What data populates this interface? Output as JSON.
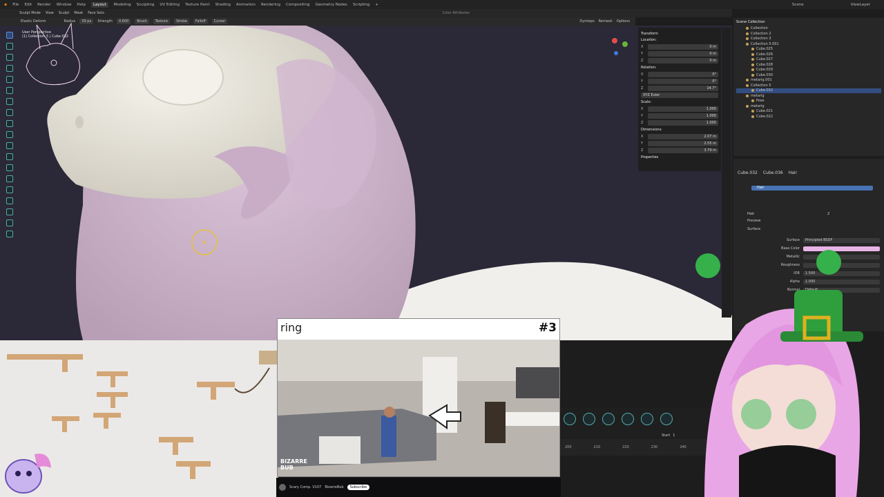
{
  "app": {
    "menu": [
      "File",
      "Edit",
      "Render",
      "Window",
      "Help"
    ],
    "workspaces": [
      "Layout",
      "Modeling",
      "Sculpting",
      "UV Editing",
      "Texture Paint",
      "Shading",
      "Animation",
      "Rendering",
      "Compositing",
      "Geometry Nodes",
      "Scripting"
    ],
    "active_workspace": "Layout",
    "scene": "Scene",
    "view_layer": "ViewLayer"
  },
  "header": {
    "mode": "Sculpt Mode",
    "items": [
      "View",
      "Sculpt",
      "Mask",
      "Face Sets"
    ],
    "right_label": "Color Attributes"
  },
  "tool_header": {
    "brush_name": "Elastic Deform",
    "radius_label": "Radius",
    "radius": "39 px",
    "strength_label": "Strength",
    "strength": "0.600",
    "dropdowns": [
      "Brush",
      "Texture",
      "Stroke",
      "Falloff",
      "Cursor"
    ],
    "right": [
      "Dyntopo",
      "Remesh",
      "Options"
    ]
  },
  "viewport": {
    "overlay_line1": "User Perspective",
    "overlay_line2": "(1) Collection 5 | Cube.032"
  },
  "n_panel": {
    "title": "Transform",
    "location_label": "Location:",
    "location": [
      [
        "X",
        "0 m"
      ],
      [
        "Y",
        "0 m"
      ],
      [
        "Z",
        "0 m"
      ]
    ],
    "rotation_label": "Rotation:",
    "rotation": [
      [
        "X",
        "0°"
      ],
      [
        "Y",
        "0°"
      ],
      [
        "Z",
        "14.7°"
      ]
    ],
    "rotation_mode": "XYZ Euler",
    "scale_label": "Scale:",
    "scale": [
      [
        "X",
        "1.000"
      ],
      [
        "Y",
        "1.000"
      ],
      [
        "Z",
        "1.000"
      ]
    ],
    "dimensions_label": "Dimensions:",
    "dimensions": [
      [
        "X",
        "2.07 m"
      ],
      [
        "Y",
        "2.55 m"
      ],
      [
        "Z",
        "3.79 m"
      ]
    ],
    "properties": "Properties"
  },
  "outliner": {
    "title": "Scene Collection",
    "items": [
      "Collection",
      "Collection 2",
      "Collection 3",
      "Collection 5.001",
      "Cube.025",
      "Cube.026",
      "Cube.027",
      "Cube.028",
      "Cube.029",
      "Cube.030",
      "metarig.001",
      "Collection 5",
      "Cube.032",
      "metarig",
      "Pose",
      "metarig",
      "Cube.021",
      "Cube.022"
    ],
    "selected_index": 12
  },
  "properties": {
    "breadcrumb": [
      "Cube.032",
      "Cube.036",
      "Hair"
    ],
    "slot": "Hair",
    "material": "Hair",
    "material_users": "2",
    "sections": [
      "Preview",
      "Surface"
    ],
    "rows": [
      [
        "Surface",
        "Principled BSDF"
      ],
      [
        "Base Color",
        ""
      ],
      [
        "Metallic",
        ""
      ],
      [
        "Roughness",
        ""
      ],
      [
        "IOR",
        "1.500"
      ],
      [
        "Alpha",
        "1.000"
      ],
      [
        "Normal",
        "Default"
      ]
    ],
    "accent": "#e8b4e6"
  },
  "timeline": {
    "frames": [
      "200",
      "210",
      "220",
      "230",
      "240"
    ],
    "start_label": "Start",
    "start": "1"
  },
  "ring": {
    "title": "ring",
    "badge": "#3",
    "watermark": "BIZARRE BUB"
  },
  "stream": {
    "title": "Scary Comp. V107",
    "channel": "BizarreBub",
    "subscribe": "Subscribe"
  },
  "colors": {
    "viewport_bg": "#2b2837",
    "model_white": "#ece9e1",
    "model_pink": "#d6bcd4",
    "vtuber_hair": "#e9a6e6",
    "vtuber_hat": "#2f9e3c"
  }
}
